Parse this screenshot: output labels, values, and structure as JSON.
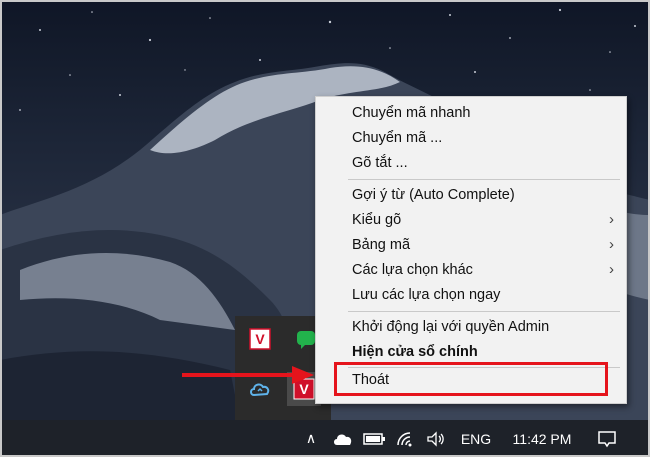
{
  "menu": {
    "items": [
      {
        "label": "Chuyển mã nhanh",
        "submenu": false,
        "bold": false
      },
      {
        "label": "Chuyển mã ...",
        "submenu": false,
        "bold": false
      },
      {
        "label": "Gõ tắt ...",
        "submenu": false,
        "bold": false
      },
      {
        "label": "Gợi ý từ (Auto Complete)",
        "submenu": false,
        "bold": false
      },
      {
        "label": "Kiểu gõ",
        "submenu": true,
        "bold": false
      },
      {
        "label": "Bảng mã",
        "submenu": true,
        "bold": false
      },
      {
        "label": "Các lựa chọn khác",
        "submenu": true,
        "bold": false
      },
      {
        "label": "Lưu các lựa chọn ngay",
        "submenu": false,
        "bold": false
      },
      {
        "label": "Khởi động lại với quyền Admin",
        "submenu": false,
        "bold": false
      },
      {
        "label": "Hiện cửa sổ chính",
        "submenu": false,
        "bold": true
      },
      {
        "label": "Thoát",
        "submenu": false,
        "bold": false
      }
    ],
    "submenu_glyph": "›"
  },
  "tray_overflow": {
    "icons": [
      "unikey-v-icon",
      "green-chat-icon",
      "cloud-sync-icon",
      "unikey-v-icon"
    ],
    "v_label": "V"
  },
  "taskbar": {
    "chevron_glyph": "∧",
    "language": "ENG",
    "time": "11:42 PM"
  },
  "colors": {
    "highlight": "#e5141c",
    "menu_bg": "#f2f2f2",
    "taskbar_bg": "#1e2229",
    "unikey_red": "#d0102a"
  }
}
